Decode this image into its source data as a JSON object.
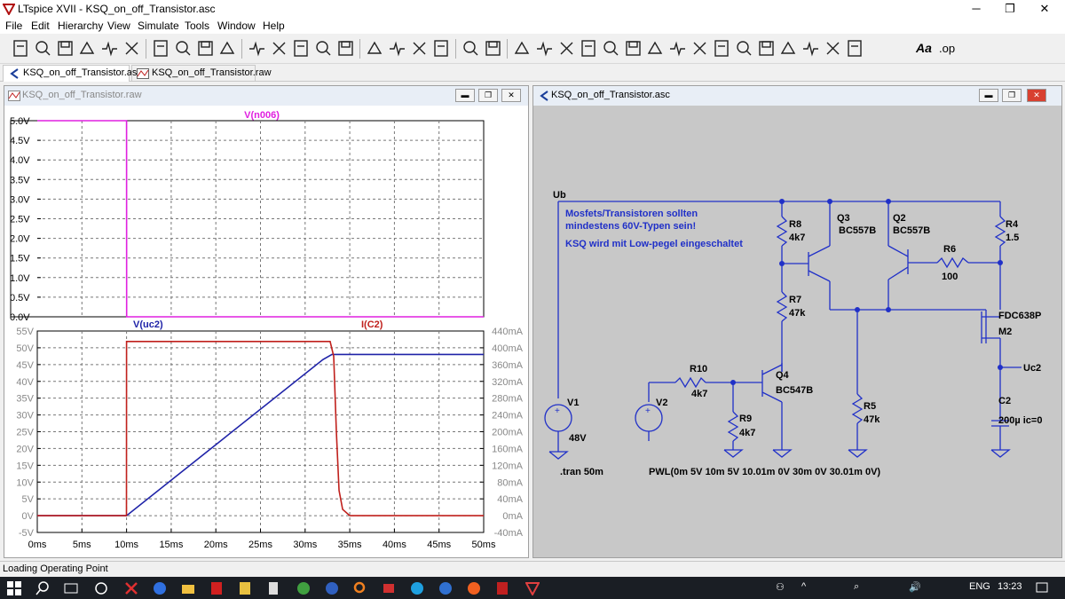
{
  "window": {
    "title": "LTspice XVII - KSQ_on_off_Transistor.asc",
    "minimize": "─",
    "maximize": "❐",
    "close": "✕"
  },
  "menu": [
    "File",
    "Edit",
    "Hierarchy",
    "View",
    "Simulate",
    "Tools",
    "Window",
    "Help"
  ],
  "toolbar": {
    "icons": [
      "new-schematic-icon",
      "open-icon",
      "save-icon",
      "control-panel-icon",
      "run-icon",
      "halt-icon",
      "zoom-in-icon",
      "zoom-out-icon",
      "zoom-fit-icon",
      "zoom-cancel-icon",
      "autorange-icon",
      "grid-icon",
      "tile-horizontal-icon",
      "tile-vertical-icon",
      "cascade-icon",
      "cut-icon",
      "copy-icon",
      "paste-icon",
      "find-icon",
      "print-icon",
      "print-setup-icon",
      "draw-wire-icon",
      "ground-icon",
      "label-net-icon",
      "resistor-icon",
      "capacitor-icon",
      "inductor-icon",
      "diode-icon",
      "component-icon",
      "move-icon",
      "drag-icon",
      "undo-icon",
      "redo-icon",
      "rotate-icon",
      "mirror-icon",
      "text-icon",
      "spice-directive-icon"
    ],
    "text_tool": "Aa",
    "op_tool": ".op"
  },
  "tabs": [
    {
      "label": "KSQ_on_off_Transistor.asc",
      "icon": "schematic-icon",
      "active": true
    },
    {
      "label": "KSQ_on_off_Transistor.raw",
      "icon": "waveform-icon",
      "active": false
    }
  ],
  "waveform_window": {
    "title": "KSQ_on_off_Transistor.raw",
    "pane1_trace": "V(n006)",
    "pane2_trace_left": "V(uc2)",
    "pane2_trace_right": "I(C2)"
  },
  "schematic_window": {
    "title": "KSQ_on_off_Transistor.asc",
    "comment_lines": [
      "Mosfets/Transistoren sollten",
      "mindestens 60V-Typen sein!",
      "KSQ wird mit Low-pegel eingeschaltet"
    ],
    "net_ub": "Ub",
    "net_uc2": "Uc2",
    "directive": ".tran 50m",
    "pwl": "PWL(0m 5V 10m 5V 10.01m 0V 30m 0V 30.01m 0V)",
    "components": [
      {
        "ref": "R8",
        "value": "4k7"
      },
      {
        "ref": "Q3",
        "value": "BC557B"
      },
      {
        "ref": "Q2",
        "value": "BC557B"
      },
      {
        "ref": "R4",
        "value": "1.5"
      },
      {
        "ref": "R6",
        "value": "100"
      },
      {
        "ref": "R7",
        "value": "47k"
      },
      {
        "ref": "M2",
        "value": "FDC638P"
      },
      {
        "ref": "R10",
        "value": "4k7"
      },
      {
        "ref": "Q4",
        "value": "BC547B"
      },
      {
        "ref": "V1",
        "value": "48V"
      },
      {
        "ref": "V2",
        "value": ""
      },
      {
        "ref": "R9",
        "value": "4k7"
      },
      {
        "ref": "R5",
        "value": "47k"
      },
      {
        "ref": "C2",
        "value": "200µ ic=0"
      }
    ]
  },
  "status": "Loading Operating Point",
  "taskbar": {
    "lang": "ENG",
    "time": "13:23"
  },
  "chart_data": [
    {
      "type": "line",
      "title": "",
      "series": [
        {
          "name": "V(n006)",
          "color": "#e020e0",
          "x": [
            0,
            10,
            10.01,
            50
          ],
          "y": [
            5,
            5,
            0,
            0
          ]
        }
      ],
      "xlim": [
        0,
        50
      ],
      "ylim": [
        0,
        5
      ],
      "yticks": [
        "0.0V",
        "0.5V",
        "1.0V",
        "1.5V",
        "2.0V",
        "2.5V",
        "3.0V",
        "3.5V",
        "4.0V",
        "4.5V",
        "5.0V"
      ],
      "grid": true
    },
    {
      "type": "line",
      "title": "",
      "xlabel": "",
      "ylabel": "",
      "xticks": [
        "0ms",
        "5ms",
        "10ms",
        "15ms",
        "20ms",
        "25ms",
        "30ms",
        "35ms",
        "40ms",
        "45ms",
        "50ms"
      ],
      "yticks_left": [
        "-5V",
        "0V",
        "5V",
        "10V",
        "15V",
        "20V",
        "25V",
        "30V",
        "35V",
        "40V",
        "45V",
        "50V",
        "55V"
      ],
      "yticks_right": [
        "-40mA",
        "0mA",
        "40mA",
        "80mA",
        "120mA",
        "160mA",
        "200mA",
        "240mA",
        "280mA",
        "320mA",
        "360mA",
        "400mA",
        "440mA"
      ],
      "series": [
        {
          "name": "V(uc2)",
          "color": "#1f23a8",
          "axis": "left",
          "x": [
            0,
            10,
            32,
            33,
            50
          ],
          "y": [
            0,
            0,
            46.5,
            48,
            48
          ]
        },
        {
          "name": "I(C2)",
          "color": "#c0201c",
          "axis": "right",
          "x": [
            0,
            9.99,
            10,
            32.8,
            33.2,
            33.5,
            33.8,
            34.2,
            35,
            50
          ],
          "y": [
            0,
            0,
            415,
            415,
            380,
            200,
            60,
            15,
            0,
            0
          ]
        }
      ],
      "xlim": [
        0,
        50
      ],
      "ylim_left": [
        -5,
        55
      ],
      "ylim_right": [
        -40,
        440
      ],
      "grid": true
    }
  ]
}
